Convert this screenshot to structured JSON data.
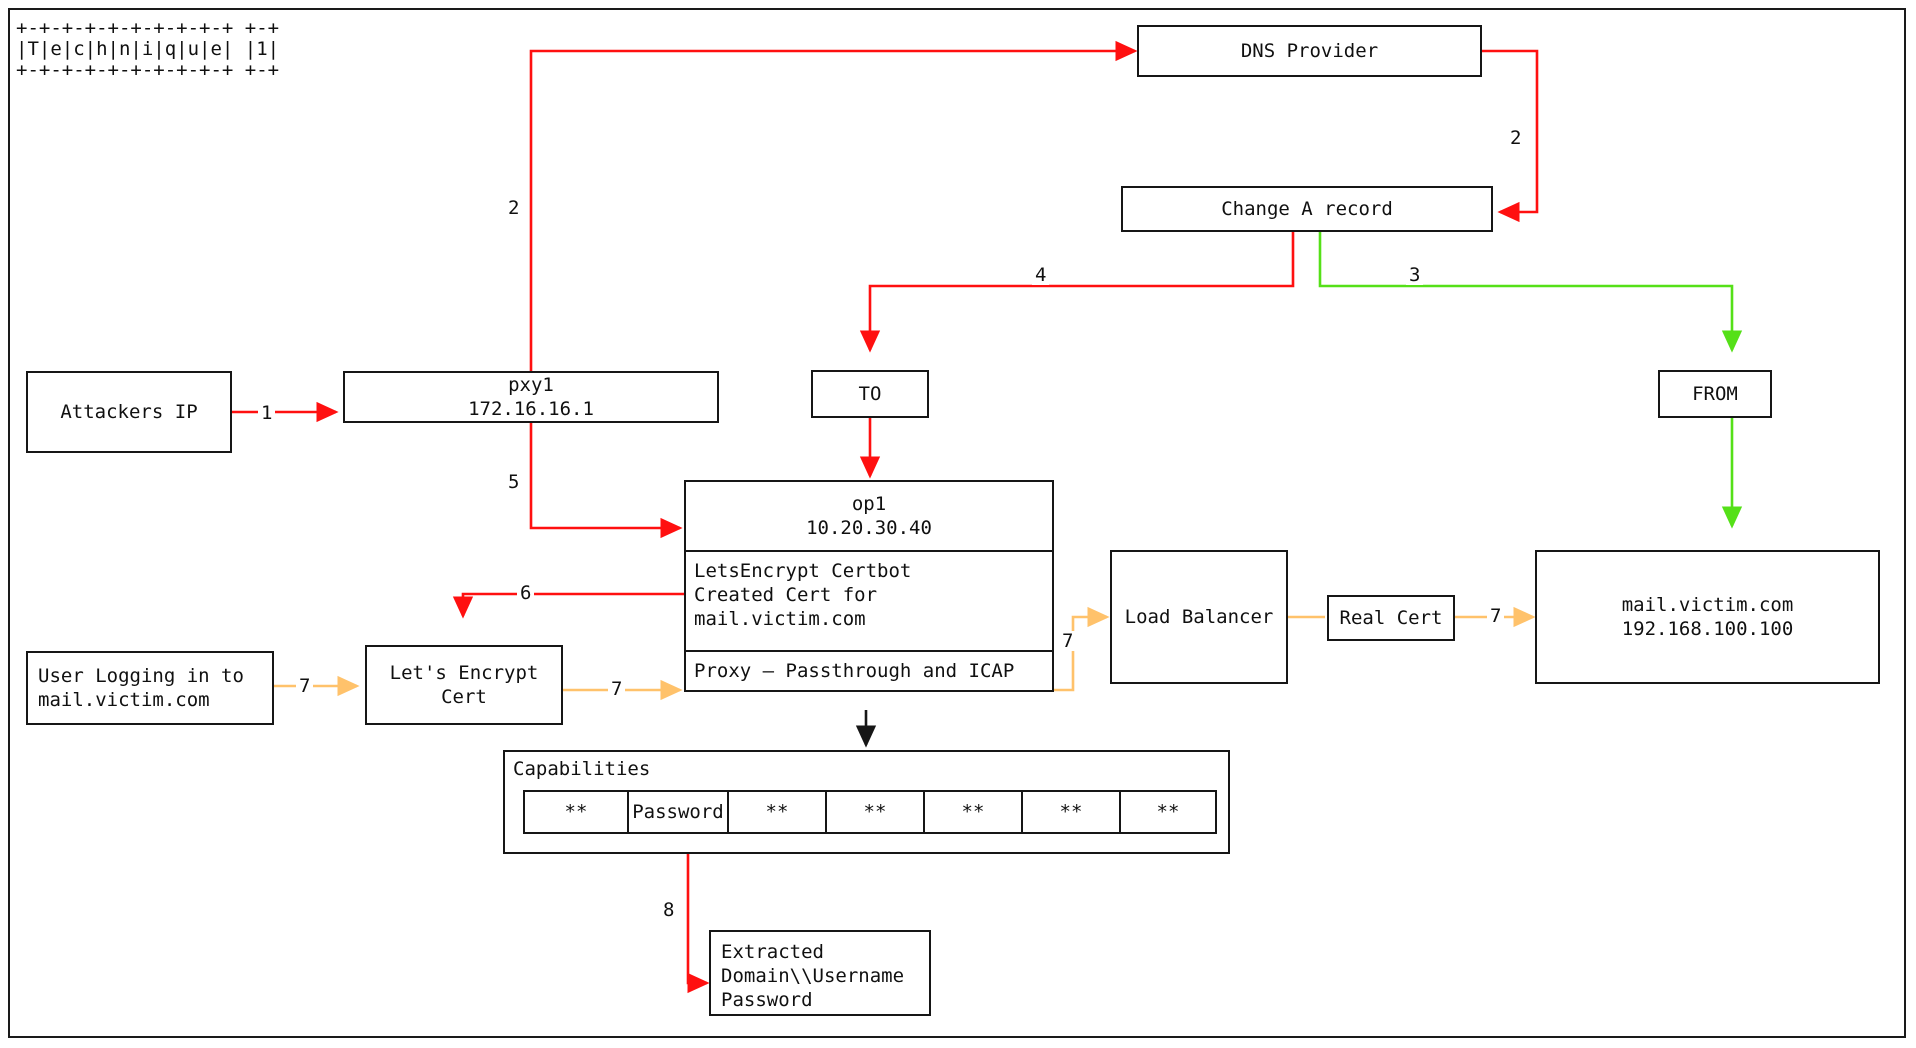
{
  "title_ascii": "+-+-+-+-+-+-+-+-+-+ +-+\n|T|e|c|h|n|i|q|u|e| |1|\n+-+-+-+-+-+-+-+-+-+ +-+",
  "title_text": "Technique 1",
  "colors": {
    "red": "#FF1010",
    "green": "#55E018",
    "orange": "#FFC26B",
    "box_border": "#161616",
    "text": "#101010",
    "background": "#ffffff"
  },
  "nodes": {
    "attackers_ip": {
      "label": "Attackers IP"
    },
    "pxy1": {
      "label": "pxy1\n172.16.16.1"
    },
    "dns_provider": {
      "label": "DNS Provider"
    },
    "change_a_record": {
      "label": "Change A record"
    },
    "to": {
      "label": "TO"
    },
    "from": {
      "label": "FROM"
    },
    "op1": {
      "header": "op1\n10.20.30.40",
      "certbot": "LetsEncrypt Certbot\nCreated Cert for\nmail.victim.com",
      "proxy": "Proxy — Passthrough and ICAP"
    },
    "user_logging": {
      "label": "User Logging in to\nmail.victim.com"
    },
    "lets_encrypt_cert": {
      "label": "Let's Encrypt\nCert"
    },
    "load_balancer": {
      "label": "Load Balancer"
    },
    "real_cert": {
      "label": "Real Cert"
    },
    "mail_victim": {
      "label": "mail.victim.com\n192.168.100.100"
    },
    "extracted": {
      "label": "Extracted\nDomain\\\\Username\nPassword"
    }
  },
  "capabilities": {
    "title": "Capabilities",
    "cells": [
      "**",
      "Password",
      "**",
      "**",
      "**",
      "**",
      "**"
    ]
  },
  "edges": [
    {
      "id": "e1",
      "label": "1",
      "from": "attackers_ip",
      "to": "pxy1",
      "color": "red"
    },
    {
      "id": "e2a",
      "label": "2",
      "from": "pxy1",
      "to": "dns_provider",
      "color": "red"
    },
    {
      "id": "e2b",
      "label": "2",
      "from": "dns_provider",
      "to": "change_a_record",
      "color": "red"
    },
    {
      "id": "e3",
      "label": "3",
      "from": "change_a_record",
      "to": "from",
      "color": "green"
    },
    {
      "id": "e4",
      "label": "4",
      "from": "change_a_record",
      "to": "to",
      "color": "red"
    },
    {
      "id": "e4b",
      "label": "",
      "from": "to",
      "to": "op1",
      "color": "red"
    },
    {
      "id": "e5",
      "label": "5",
      "from": "pxy1",
      "to": "op1",
      "color": "red"
    },
    {
      "id": "e6",
      "label": "6",
      "from": "op1_certbot",
      "to": "lets_encrypt_cert",
      "color": "red"
    },
    {
      "id": "e7a",
      "label": "7",
      "from": "user_logging",
      "to": "lets_encrypt_cert",
      "color": "orange"
    },
    {
      "id": "e7b",
      "label": "7",
      "from": "lets_encrypt_cert",
      "to": "op1_proxy",
      "color": "orange"
    },
    {
      "id": "e7c",
      "label": "7",
      "from": "op1_proxy",
      "to": "load_balancer",
      "color": "orange"
    },
    {
      "id": "e7d",
      "label": "",
      "from": "load_balancer",
      "to": "real_cert",
      "color": "orange"
    },
    {
      "id": "e7e",
      "label": "7",
      "from": "real_cert",
      "to": "mail_victim",
      "color": "orange"
    },
    {
      "id": "e3b",
      "label": "",
      "from": "from",
      "to": "mail_victim",
      "color": "green"
    },
    {
      "id": "e_cap",
      "label": "",
      "from": "op1_proxy",
      "to": "capabilities",
      "color": "black"
    },
    {
      "id": "e8",
      "label": "8",
      "from": "capabilities_password",
      "to": "extracted",
      "color": "red"
    }
  ]
}
